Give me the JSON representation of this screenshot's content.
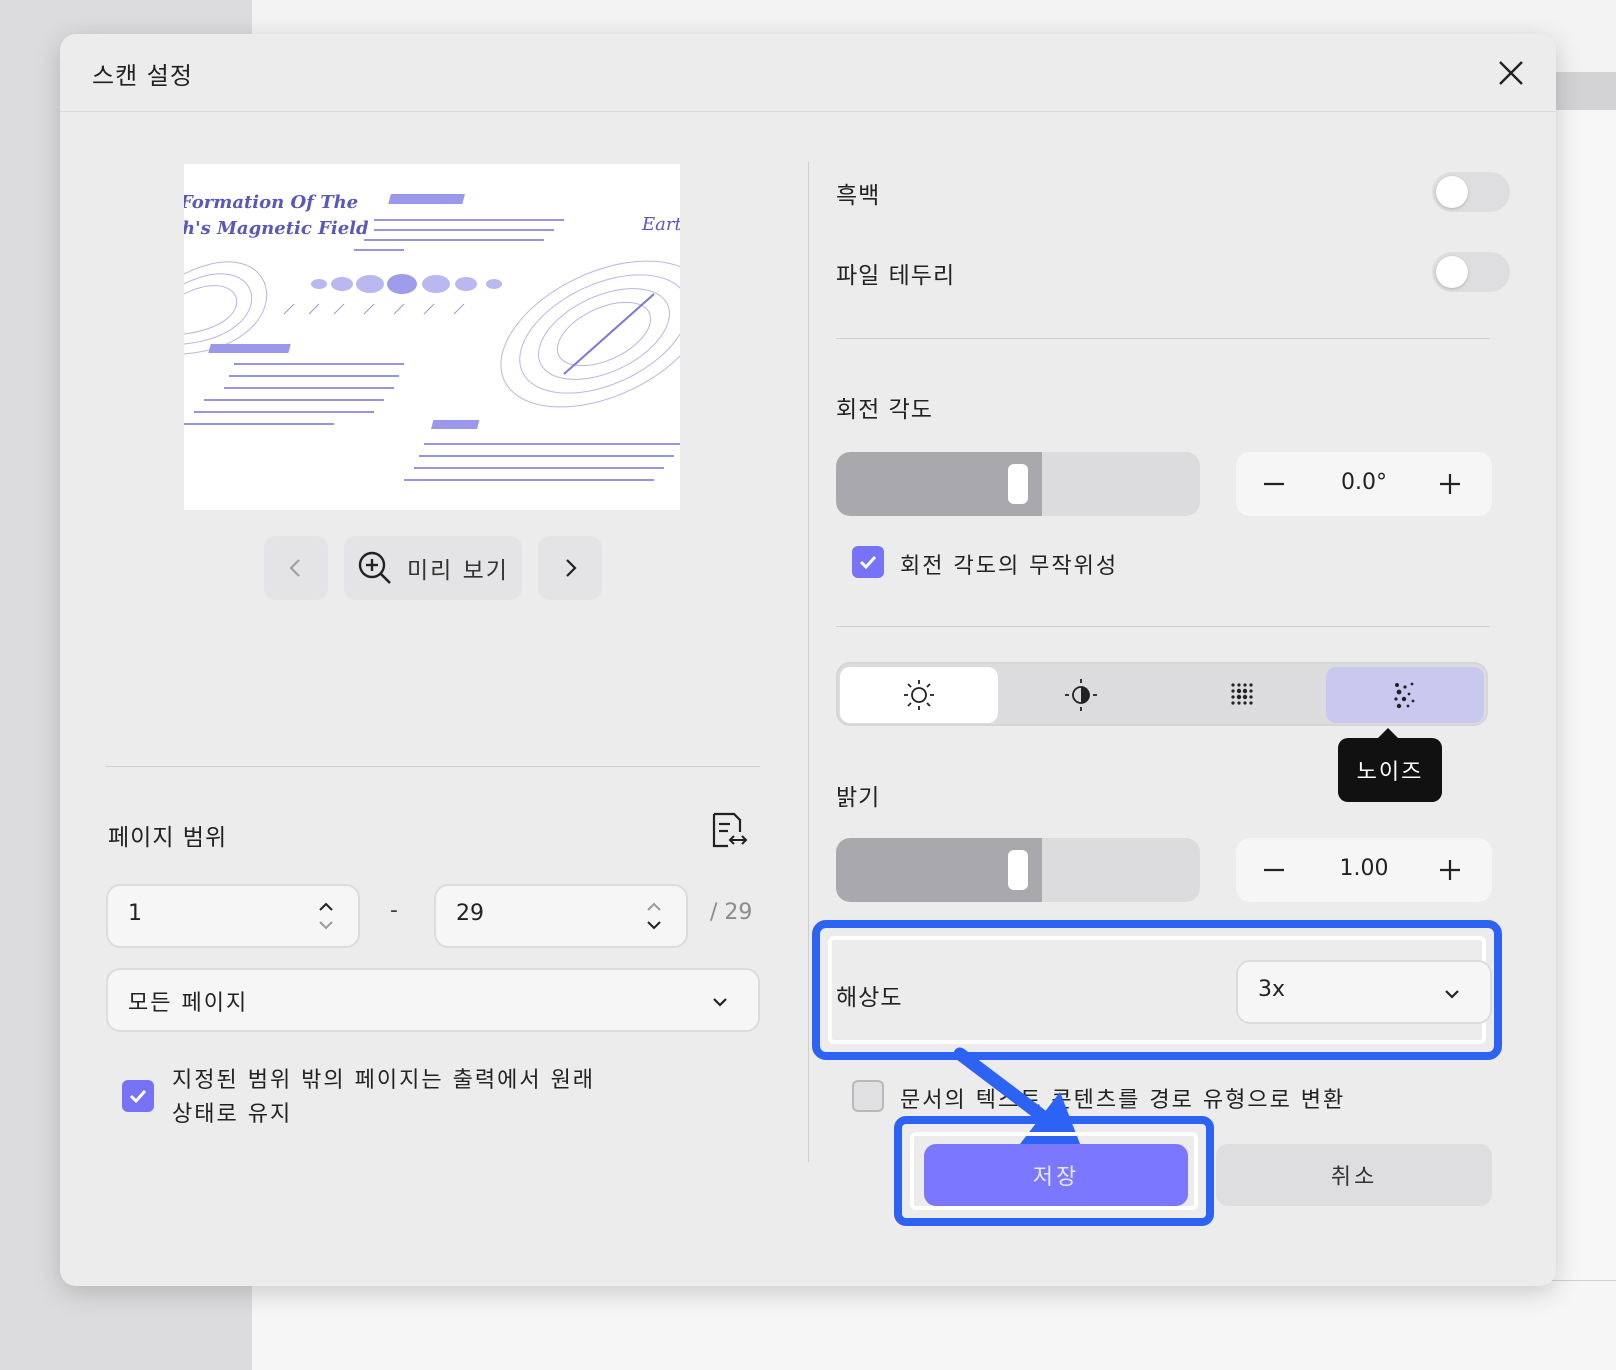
{
  "dialog": {
    "title": "스캔 설정"
  },
  "preview": {
    "preview_label": "미리 보기",
    "thumbnail_text": {
      "title_line1": "Formation Of The",
      "title_line2": "h's Magnetic Field",
      "right_title": "Eart"
    }
  },
  "page_range": {
    "label": "페이지 범위",
    "from_value": "1",
    "separator": "-",
    "to_value": "29",
    "total": "/ 29",
    "mode_selected": "모든 페이지",
    "keep_outside_label_line1": "지정된 범위 밖의 페이지는 출력에서 원래",
    "keep_outside_label_line2": "상태로 유지"
  },
  "settings": {
    "grayscale_label": "흑백",
    "grayscale_on": false,
    "file_border_label": "파일 테두리",
    "file_border_on": false,
    "rotation_label": "회전 각도",
    "rotation_value": "0.0°",
    "rotation_slider_level": 0.5,
    "rotation_random_label": "회전 각도의 무작위성",
    "rotation_random_checked": true,
    "adjust_tabs": [
      {
        "icon": "sun-icon"
      },
      {
        "icon": "contrast-icon"
      },
      {
        "icon": "dots-grid-icon"
      },
      {
        "icon": "noise-icon"
      }
    ],
    "tooltip": "노이즈",
    "brightness_label": "밝기",
    "brightness_value": "1.00",
    "brightness_slider_level": 0.5,
    "resolution_label": "해상도",
    "resolution_selected": "3x",
    "text_to_path_label": "문서의 텍스트 콘텐츠를 경로 유형으로 변환",
    "text_to_path_checked": false
  },
  "actions": {
    "save_label": "저장",
    "cancel_label": "취소"
  },
  "colors": {
    "accent": "#7b78ff",
    "highlight": "#2d63f5",
    "checkbox": "#7673f6"
  }
}
